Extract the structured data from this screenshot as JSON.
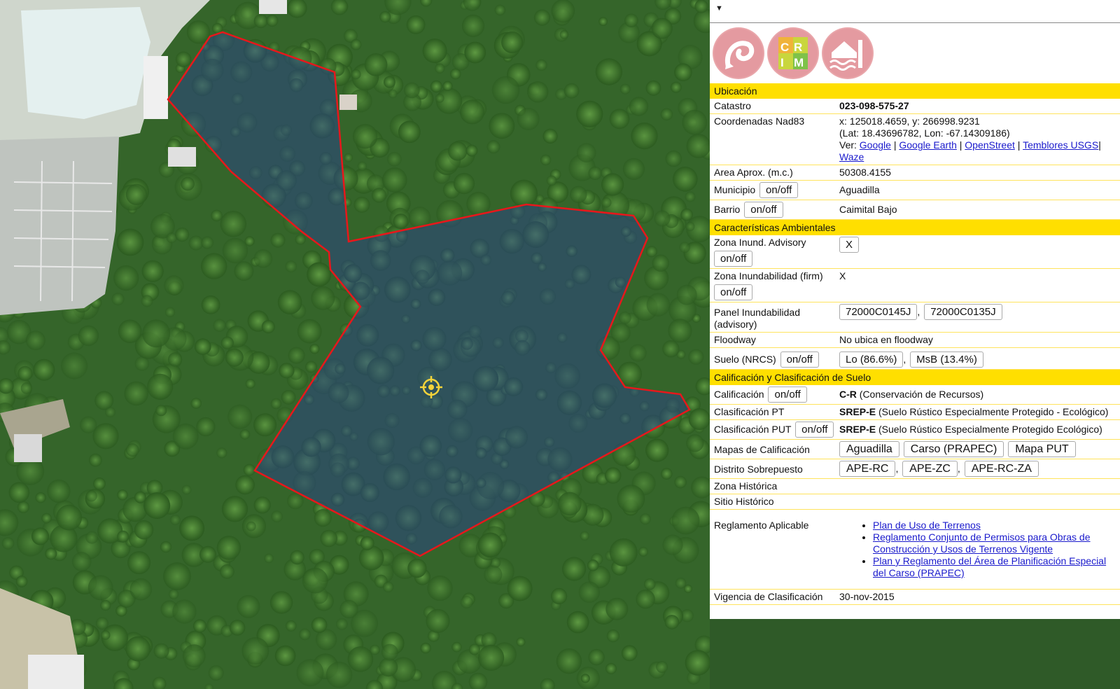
{
  "colors": {
    "section": "#ffdf00",
    "link": "#1a1acc",
    "parcel_outline": "#e8171b"
  },
  "map": {
    "marker_icon": "crosshair-target-icon"
  },
  "logos": [
    {
      "name": "ogpe-logo"
    },
    {
      "name": "crim-logo",
      "text": "CRIM"
    },
    {
      "name": "flood-house-logo"
    }
  ],
  "sections": {
    "ubicacion": "Ubicación",
    "ambientales": "Características Ambientales",
    "calificacion": "Calificación y Clasificación de Suelo"
  },
  "ubicacion": {
    "catastro_label": "Catastro",
    "catastro_value": "023-098-575-27",
    "coord_label": "Coordenadas Nad83",
    "coord_xy": "x: 125018.4659, y: 266998.9231",
    "coord_latlon": "(Lat: 18.43696782, Lon: -67.14309186)",
    "ver_label": "Ver:",
    "links": [
      "Google",
      "Google Earth",
      "OpenStreet",
      "Temblores USGS",
      "Waze"
    ],
    "area_label": "Area Aprox. (m.c.)",
    "area_value": "50308.4155",
    "municipio_label": "Municipio",
    "municipio_value": "Aguadilla",
    "barrio_label": "Barrio",
    "barrio_value": "Caimital Bajo",
    "onoff": "on/off"
  },
  "ambientales": {
    "zona_inund_adv_label": "Zona Inund. Advisory",
    "zona_inund_adv_value": "X",
    "zona_inund_firm_label": "Zona Inundabilidad (firm)",
    "zona_inund_firm_value": "X",
    "panel_label": "Panel Inundabilidad (advisory)",
    "panels": [
      "72000C0145J",
      "72000C0135J"
    ],
    "floodway_label": "Floodway",
    "floodway_value": "No ubica en floodway",
    "suelo_label": "Suelo (NRCS)",
    "suelos": [
      "Lo (86.6%)",
      "MsB (13.4%)"
    ]
  },
  "calificacion": {
    "calif_label": "Calificación",
    "calif_code": "C-R",
    "calif_desc": "(Conservación de Recursos)",
    "pt_label": "Clasificación PT",
    "pt_code": "SREP-E",
    "pt_desc": "(Suelo Rústico Especialmente Protegido - Ecológico)",
    "put_label": "Clasificación PUT",
    "put_code": "SREP-E",
    "put_desc": "(Suelo Rústico Especialmente Protegido Ecológico)",
    "mapas_label": "Mapas de Calificación",
    "mapas": [
      "Aguadilla",
      "Carso (PRAPEC)",
      "Mapa PUT"
    ],
    "distrito_label": "Distrito Sobrepuesto",
    "distritos": [
      "APE-RC",
      "APE-ZC",
      "APE-RC-ZA"
    ],
    "zona_hist_label": "Zona Histórica",
    "sitio_hist_label": "Sitio Histórico",
    "reglamento_label": "Reglamento Aplicable",
    "reglamentos": [
      "Plan de Uso de Terrenos",
      "Reglamento Conjunto de Permisos para Obras de Construcción y Usos de Terrenos Vigente",
      "Plan y Reglamento del Área de Planificación Especial del Carso (PRAPEC)"
    ],
    "vigencia_label": "Vigencia de Clasificación",
    "vigencia_value": "30-nov-2015"
  }
}
